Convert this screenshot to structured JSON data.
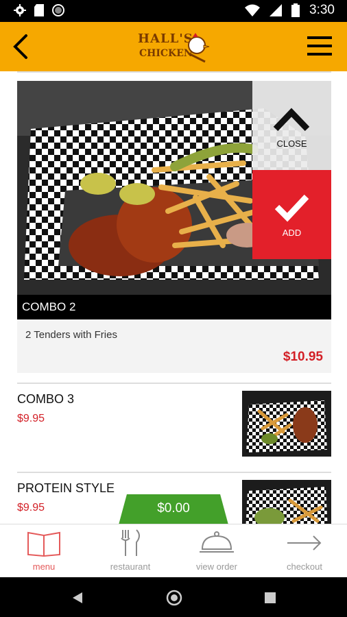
{
  "status_bar": {
    "time": "3:30"
  },
  "app_bar": {
    "logo_line1": "HALL'S",
    "logo_line2": "CHICKEN"
  },
  "featured": {
    "title": "COMBO 2",
    "description": "2 Tenders with Fries",
    "price": "$10.95",
    "close_label": "CLOSE",
    "add_label": "ADD"
  },
  "items": [
    {
      "name": "COMBO 3",
      "price": "$9.95"
    },
    {
      "name": "PROTEIN STYLE",
      "price": "$9.95"
    }
  ],
  "cart": {
    "total": "$0.00"
  },
  "bottom_nav": [
    {
      "label": "menu",
      "icon": "book-icon"
    },
    {
      "label": "restaurant",
      "icon": "fork-knife-icon"
    },
    {
      "label": "view order",
      "icon": "cloche-icon"
    },
    {
      "label": "checkout",
      "icon": "arrow-right-icon"
    }
  ],
  "colors": {
    "accent": "#f6a800",
    "add": "#e3202a",
    "price": "#d31f26",
    "cart": "#43a02a",
    "active_nav": "#e45a5a"
  }
}
